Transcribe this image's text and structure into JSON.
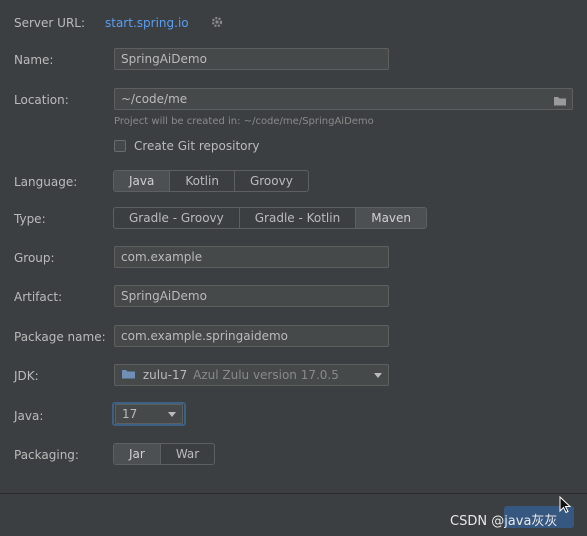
{
  "server": {
    "label": "Server URL:",
    "url": "start.spring.io",
    "settings_icon": "gear-icon"
  },
  "name": {
    "label": "Name:",
    "value": "SpringAiDemo"
  },
  "location": {
    "label": "Location:",
    "value": "~/code/me",
    "hint": "Project will be created in: ~/code/me/SpringAiDemo",
    "folder_icon": "folder-icon"
  },
  "git": {
    "label": "Create Git repository",
    "checked": false
  },
  "language": {
    "label": "Language:",
    "options": [
      "Java",
      "Kotlin",
      "Groovy"
    ],
    "selected": "Java"
  },
  "type": {
    "label": "Type:",
    "options": [
      "Gradle - Groovy",
      "Gradle - Kotlin",
      "Maven"
    ],
    "selected": "Maven"
  },
  "group": {
    "label": "Group:",
    "value": "com.example"
  },
  "artifact": {
    "label": "Artifact:",
    "value": "SpringAiDemo"
  },
  "package": {
    "label": "Package name:",
    "value": "com.example.springaidemo"
  },
  "jdk": {
    "label": "JDK:",
    "name": "zulu-17",
    "detail": "Azul Zulu version 17.0.5"
  },
  "java": {
    "label": "Java:",
    "value": "17"
  },
  "packaging": {
    "label": "Packaging:",
    "options": [
      "Jar",
      "War"
    ],
    "selected": "Jar"
  },
  "watermark": "CSDN @java灰灰"
}
